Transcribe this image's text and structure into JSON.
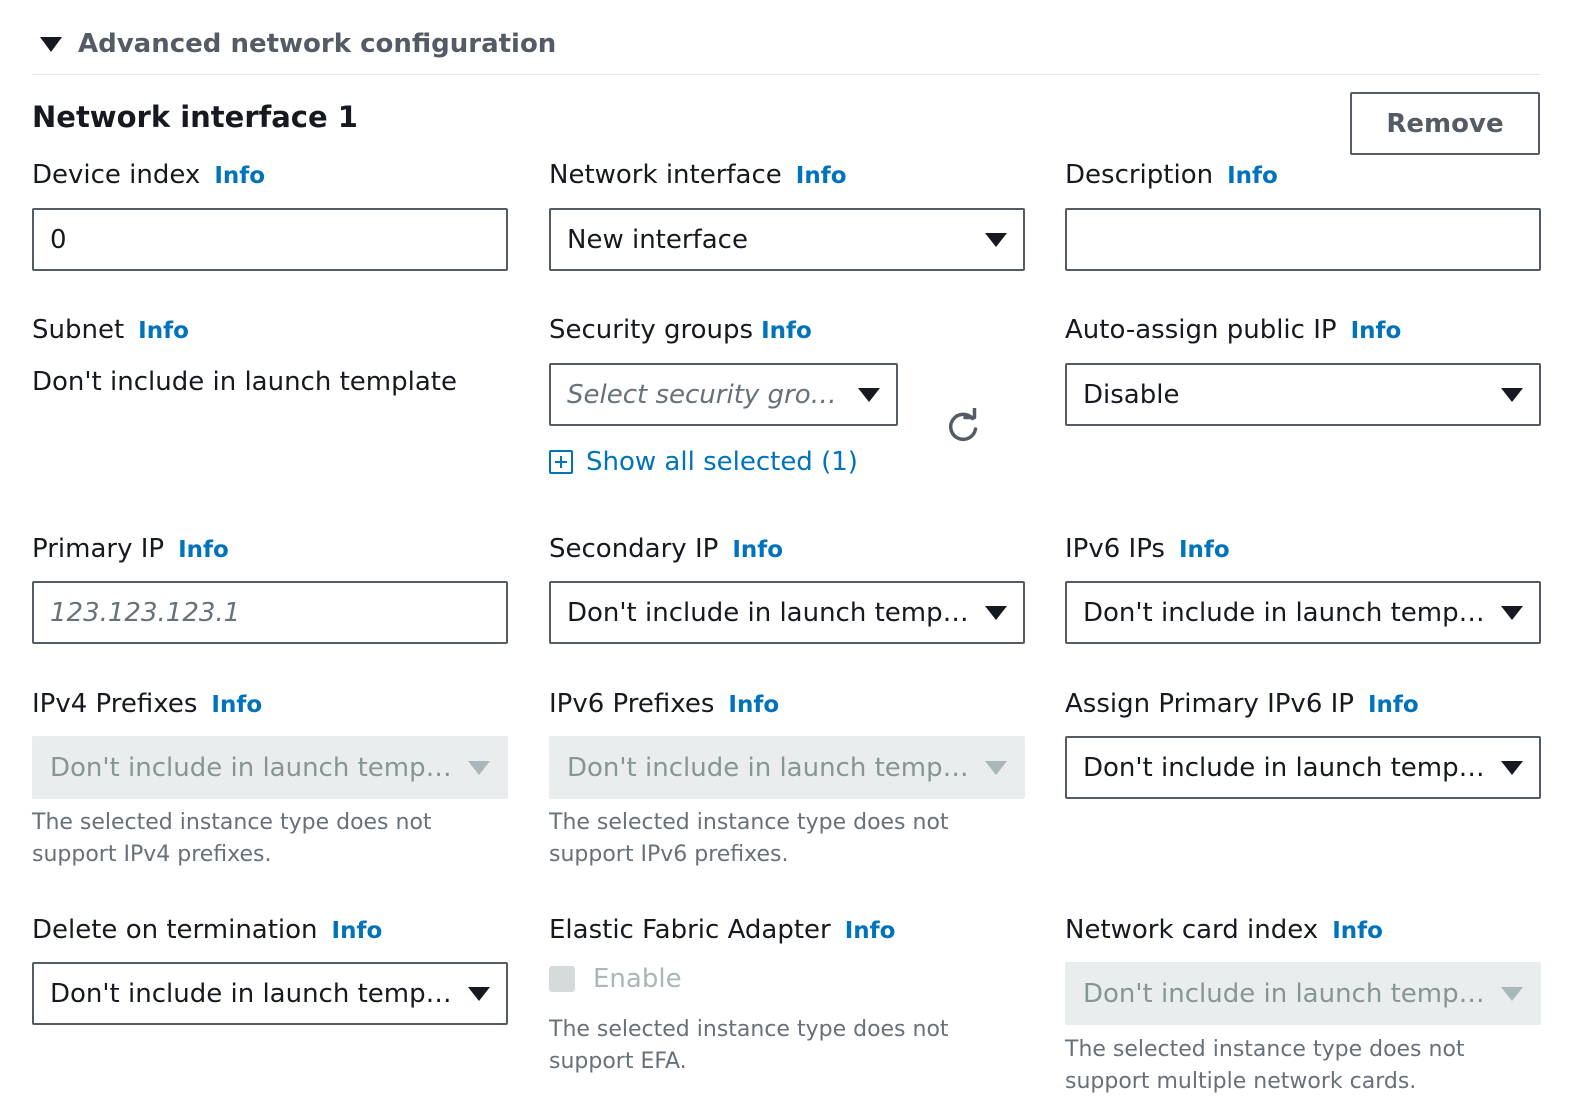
{
  "section": {
    "title": "Advanced network configuration"
  },
  "interface": {
    "title": "Network interface 1",
    "remove_label": "Remove",
    "info_label": "Info",
    "device_index": {
      "label": "Device index",
      "value": "0"
    },
    "network_interface": {
      "label": "Network interface",
      "value": "New interface"
    },
    "description": {
      "label": "Description",
      "value": ""
    },
    "subnet": {
      "label": "Subnet",
      "value": "Don't include in launch template"
    },
    "security_groups": {
      "label": "Security groups",
      "placeholder": "Select security groups",
      "show_all": "Show all selected (1)"
    },
    "auto_assign_public_ip": {
      "label": "Auto-assign public IP",
      "value": "Disable"
    },
    "primary_ip": {
      "label": "Primary IP",
      "placeholder": "123.123.123.1"
    },
    "secondary_ip": {
      "label": "Secondary IP",
      "value": "Don't include in launch temp…"
    },
    "ipv6_ips": {
      "label": "IPv6 IPs",
      "value": "Don't include in launch temp…"
    },
    "ipv4_prefixes": {
      "label": "IPv4 Prefixes",
      "value": "Don't include in launch temp…",
      "helper": "The selected instance type does not support IPv4 prefixes."
    },
    "ipv6_prefixes": {
      "label": "IPv6 Prefixes",
      "value": "Don't include in launch temp…",
      "helper": "The selected instance type does not support IPv6 prefixes."
    },
    "assign_primary_ipv6": {
      "label": "Assign Primary IPv6 IP",
      "value": "Don't include in launch temp…"
    },
    "delete_on_termination": {
      "label": "Delete on termination",
      "value": "Don't include in launch temp…"
    },
    "efa": {
      "label": "Elastic Fabric Adapter",
      "checkbox_label": "Enable",
      "helper": "The selected instance type does not support EFA."
    },
    "network_card_index": {
      "label": "Network card index",
      "value": "Don't include in launch temp…",
      "helper": "The selected instance type does not support multiple network cards."
    }
  },
  "icons": {
    "caret": "caret-down-icon",
    "dropdown": "triangle-down-icon",
    "refresh": "refresh-icon",
    "expand": "plus-square-icon"
  },
  "colors": {
    "link": "#0073bb",
    "text": "#16191f",
    "border": "#545b64",
    "disabled_bg": "#eaeded",
    "muted": "#687078"
  }
}
